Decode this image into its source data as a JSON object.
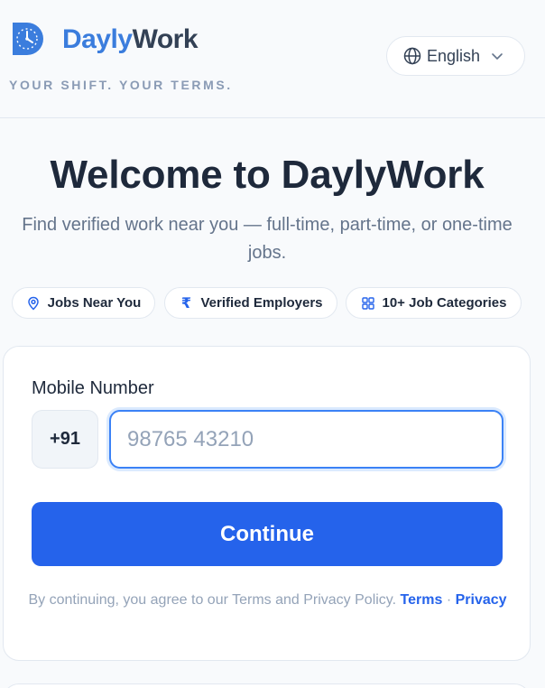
{
  "header": {
    "brand_part1": "Dayly",
    "brand_part2": "Work",
    "tagline": "YOUR SHIFT. YOUR TERMS.",
    "language": {
      "label": "English",
      "icon": "globe-icon"
    }
  },
  "hero": {
    "title": "Welcome to DaylyWork",
    "subtitle": "Find verified work near you — full-time, part-time, or one-time jobs."
  },
  "features": [
    {
      "label": "Jobs Near You",
      "icon": "location-pin-icon"
    },
    {
      "label": "Verified Employers",
      "icon": "rupee-icon",
      "glyph": "₹"
    },
    {
      "label": "10+ Job Categories",
      "icon": "grid-icon"
    }
  ],
  "form": {
    "mobile_label": "Mobile Number",
    "country_code": "+91",
    "phone_value": "",
    "phone_placeholder": "98765 43210",
    "continue_label": "Continue",
    "legal_text": "By continuing, you agree to our Terms and Privacy Policy.",
    "terms_link": "Terms",
    "separator": "·",
    "privacy_link": "Privacy"
  },
  "colors": {
    "primary": "#2563eb",
    "brand_blue": "#3b7ddd",
    "text_dark": "#1e293b",
    "muted": "#94a3b8",
    "background": "#f8fafc"
  }
}
